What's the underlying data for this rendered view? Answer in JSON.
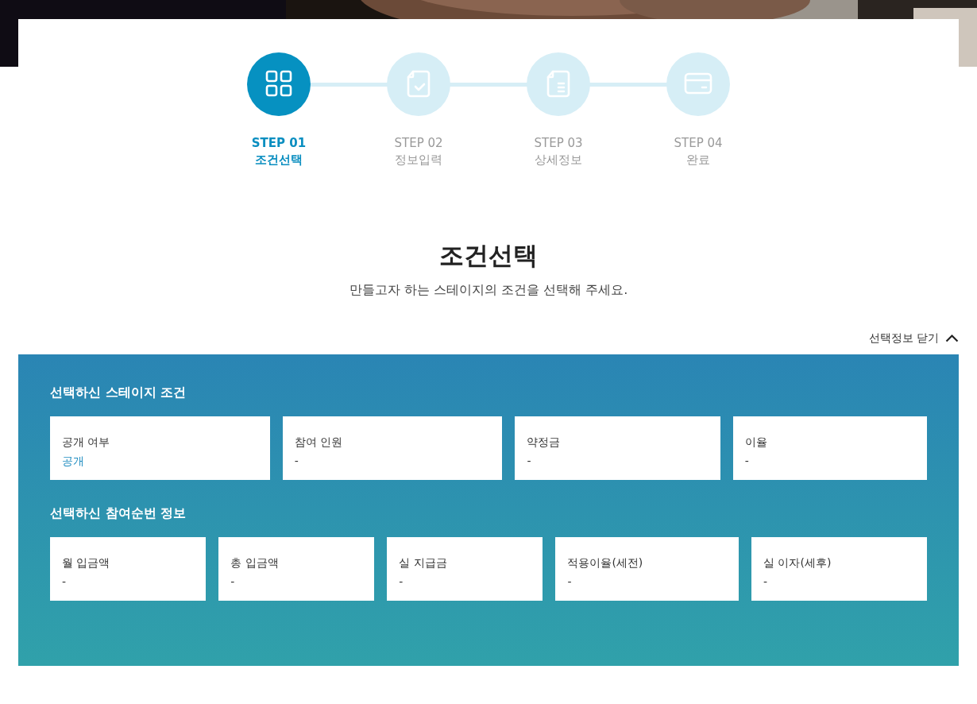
{
  "steps": [
    {
      "step": "STEP 01",
      "label": "조건선택",
      "kind": "grid",
      "selected": true
    },
    {
      "step": "STEP 02",
      "label": "정보입력",
      "kind": "doc-check",
      "selected": false
    },
    {
      "step": "STEP 03",
      "label": "상세정보",
      "kind": "doc-lines",
      "selected": false
    },
    {
      "step": "STEP 04",
      "label": "완료",
      "kind": "card",
      "selected": false
    }
  ],
  "title": "조건선택",
  "subtitle": "만들고자 하는 스테이지의 조건을 선택해 주세요.",
  "toggle": {
    "label": "선택정보 닫기",
    "expanded": true
  },
  "sections": [
    {
      "heading": "선택하신 스테이지 조건",
      "items": [
        {
          "label": "공개 여부",
          "value": "공개",
          "filled": true
        },
        {
          "label": "참여 인원",
          "value": "-",
          "filled": false
        },
        {
          "label": "약정금",
          "value": "-",
          "filled": false
        },
        {
          "label": "이율",
          "value": "-",
          "filled": false
        }
      ]
    },
    {
      "heading": "선택하신 참여순번 정보",
      "items": [
        {
          "label": "월 입금액",
          "value": "-",
          "filled": false
        },
        {
          "label": "총 입금액",
          "value": "-",
          "filled": false
        },
        {
          "label": "실 지급금",
          "value": "-",
          "filled": false
        },
        {
          "label": "적용이율(세전)",
          "value": "-",
          "filled": false
        },
        {
          "label": "실 이자(세후)",
          "value": "-",
          "filled": false
        }
      ]
    }
  ]
}
